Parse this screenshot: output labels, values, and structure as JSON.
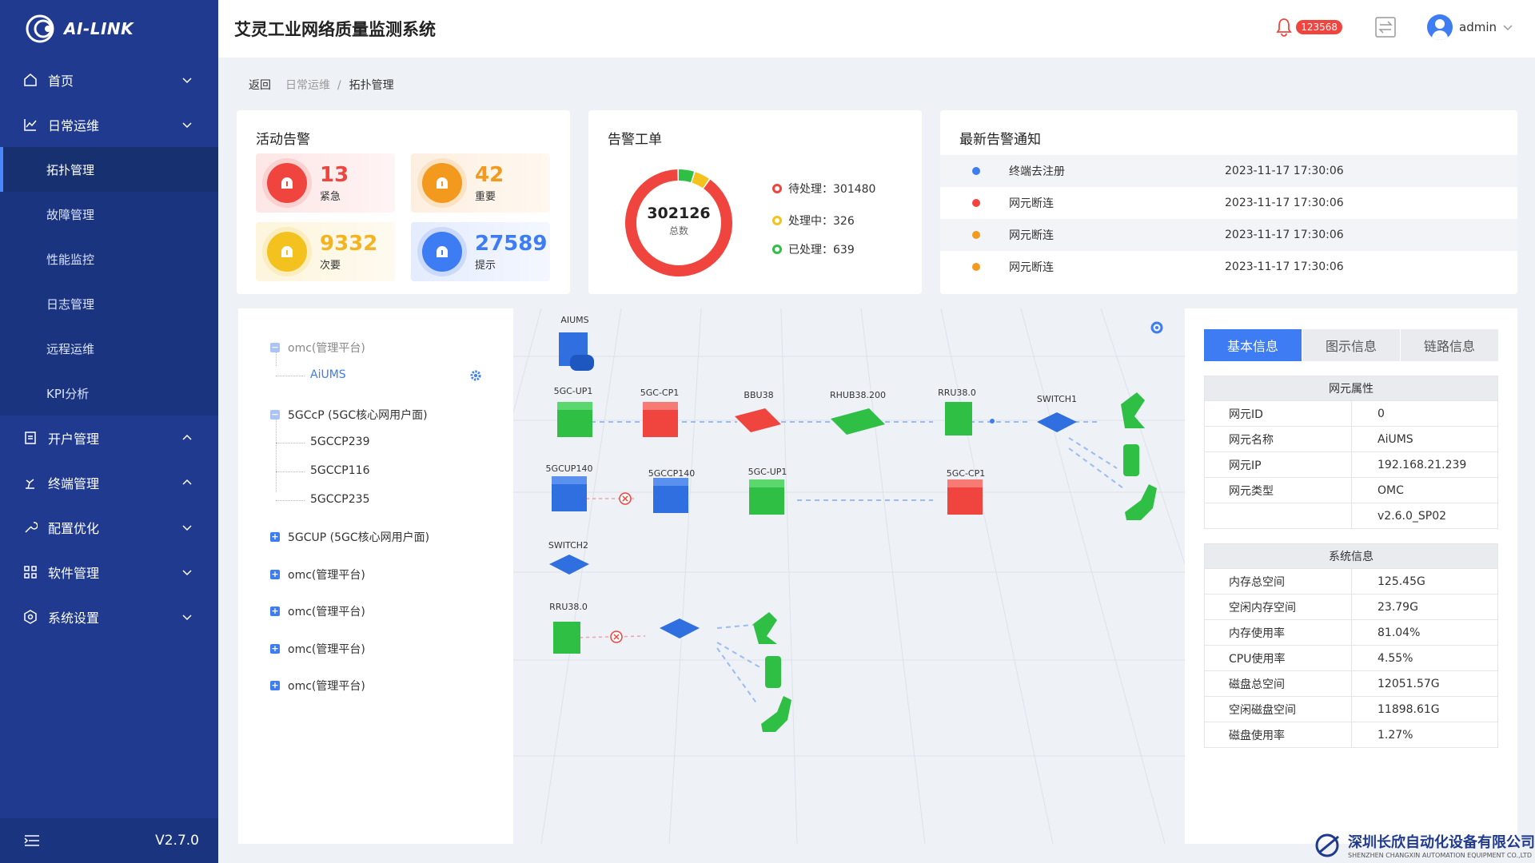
{
  "app": {
    "logo_text": "AI-LINK",
    "title": "艾灵工业网络质量监测系统",
    "version": "V2.7.0"
  },
  "header": {
    "notification_count": "123568",
    "username": "admin"
  },
  "sidebar": {
    "items": [
      {
        "label": "首页"
      },
      {
        "label": "日常运维"
      },
      {
        "label": "开户管理"
      },
      {
        "label": "终端管理"
      },
      {
        "label": "配置优化"
      },
      {
        "label": "软件管理"
      },
      {
        "label": "系统设置"
      }
    ],
    "sub_items": [
      {
        "label": "拓扑管理"
      },
      {
        "label": "故障管理"
      },
      {
        "label": "性能监控"
      },
      {
        "label": "日志管理"
      },
      {
        "label": "远程运维"
      },
      {
        "label": "KPI分析"
      }
    ]
  },
  "breadcrumb": {
    "back": "返回",
    "parent": "日常运维",
    "separator": "/",
    "current": "拓扑管理"
  },
  "active_alarms": {
    "title": "活动告警",
    "tiles": [
      {
        "value": "13",
        "label": "紧急",
        "color": "#f0453e"
      },
      {
        "value": "42",
        "label": "重要",
        "color": "#f39a1e"
      },
      {
        "value": "9332",
        "label": "次要",
        "color": "#f4c21f"
      },
      {
        "value": "27589",
        "label": "提示",
        "color": "#3d7cf2"
      }
    ]
  },
  "tickets": {
    "title": "告警工单",
    "total": "302126",
    "total_label": "总数",
    "legend": [
      {
        "label": "待处理：301480",
        "value": 301480,
        "color": "#f0453e"
      },
      {
        "label": "处理中：326",
        "value": 326,
        "color": "#f4c21f"
      },
      {
        "label": "已处理：639",
        "value": 639,
        "color": "#2fbf45"
      }
    ]
  },
  "notices": {
    "title": "最新告警通知",
    "rows": [
      {
        "text": "终端去注册",
        "time": "2023-11-17 17:30:06",
        "color": "#3d7cf2"
      },
      {
        "text": "网元断连",
        "time": "2023-11-17 17:30:06",
        "color": "#f0453e"
      },
      {
        "text": "网元断连",
        "time": "2023-11-17 17:30:06",
        "color": "#f39a1e"
      },
      {
        "text": "网元断连",
        "time": "2023-11-17 17:30:06",
        "color": "#f39a1e"
      }
    ]
  },
  "tree": {
    "nodes": [
      {
        "label": "omc(管理平台)"
      },
      {
        "label": "AiUMS"
      },
      {
        "label": "5GCcP (5GC核心网用户面)"
      },
      {
        "label": "5GCCP239"
      },
      {
        "label": "5GCCP116"
      },
      {
        "label": "5GCCP235"
      },
      {
        "label": "5GCUP (5GC核心网用户面)"
      },
      {
        "label": "omc(管理平台)"
      },
      {
        "label": "omc(管理平台)"
      },
      {
        "label": "omc(管理平台)"
      },
      {
        "label": "omc(管理平台)"
      }
    ]
  },
  "topology": {
    "labels": [
      "AIUMS",
      "5GC-UP1",
      "5GC-CP1",
      "BBU38",
      "RHUB38.200",
      "RRU38.0",
      "SWITCH1",
      "5GCUP140",
      "5GCCP140",
      "5GC-UP1",
      "5GC-CP1",
      "SWITCH2",
      "RRU38.0"
    ]
  },
  "info": {
    "tabs": [
      "基本信息",
      "图示信息",
      "链路信息"
    ],
    "ne_title": "网元属性",
    "ne_rows": [
      {
        "k": "网元ID",
        "v": "0"
      },
      {
        "k": "网元名称",
        "v": "AiUMS"
      },
      {
        "k": "网元IP",
        "v": "192.168.21.239"
      },
      {
        "k": "网元类型",
        "v": "OMC"
      },
      {
        "k": "",
        "v": "v2.6.0_SP02"
      }
    ],
    "sys_title": "系统信息",
    "sys_rows": [
      {
        "k": "内存总空间",
        "v": "125.45G"
      },
      {
        "k": "空闲内存空间",
        "v": "23.79G"
      },
      {
        "k": "内存使用率",
        "v": "81.04%"
      },
      {
        "k": "CPU使用率",
        "v": "4.55%"
      },
      {
        "k": "磁盘总空间",
        "v": "12051.57G"
      },
      {
        "k": "空闲磁盘空间",
        "v": "11898.61G"
      },
      {
        "k": "磁盘使用率",
        "v": "1.27%"
      }
    ]
  },
  "watermark": {
    "cn": "深圳长欣自动化设备有限公司",
    "en": "SHENZHEN CHANGXIN AUTOMATION EQUIPMENT CO.,LTD"
  }
}
